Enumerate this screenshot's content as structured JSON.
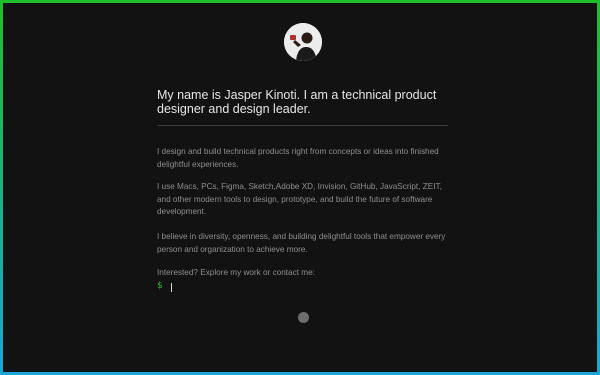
{
  "profile": {
    "avatar_alt": "Jasper Kinoti",
    "headline": "My name is Jasper Kinoti. I am a technical product designer and design leader."
  },
  "about": {
    "paragraphs": [
      "I design and build technical products right from concepts or ideas into finished delightful experiences.",
      "I use Macs, PCs, Figma, Sketch,Adobe XD, Invision, GitHub, JavaScript, ZEIT, and other modern tools to design, prototype, and build the future of software development.",
      "I believe in diversity, openness, and building delightful tools that empower every person and organization to achieve more.",
      "Interested? Explore my work or contact me:"
    ]
  },
  "terminal": {
    "prompt": "$"
  },
  "footer": {
    "lines": [
      "",
      "",
      ""
    ]
  },
  "colors": {
    "page_bg": "#121212",
    "accent_green": "#2fbf3a",
    "border_top": "#1fbf2a",
    "border_bottom": "#1aa7d6"
  }
}
